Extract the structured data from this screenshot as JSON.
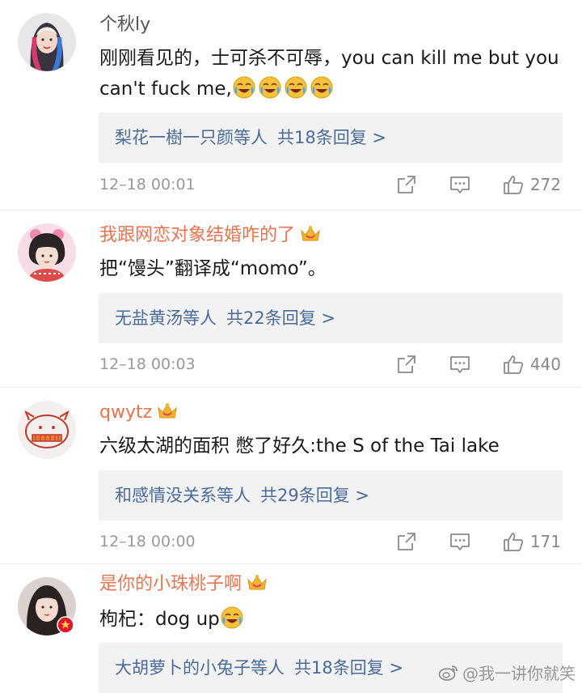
{
  "comments": [
    {
      "username": "个秋ly",
      "is_vip": false,
      "text": "刚刚看见的，士可杀不可辱，you can kill me but you can't fuck me,",
      "emoji_count": 4,
      "reply_users": "梨花一樹一只颜等人",
      "reply_count": "共18条回复 >",
      "time": "12–18 00:01",
      "likes": "272"
    },
    {
      "username": "我跟网恋对象结婚咋的了",
      "is_vip": true,
      "text": "把“馒头”翻译成“momo”。",
      "emoji_count": 0,
      "reply_users": "无盐黄汤等人",
      "reply_count": "共22条回复 >",
      "time": "12–18 00:03",
      "likes": "440"
    },
    {
      "username": "qwytz",
      "is_vip": true,
      "text": "六级太湖的面积 憋了好久:the S of the Tai lake",
      "emoji_count": 0,
      "reply_users": "和感情没关系等人",
      "reply_count": "共29条回复 >",
      "time": "12–18 00:00",
      "likes": "171"
    },
    {
      "username": "是你的小珠桃子啊",
      "is_vip": true,
      "text": "枸杞：dog up",
      "emoji_count": 1,
      "reply_users": "大胡萝卜的小兔子等人",
      "reply_count": "共18条回复 >"
    }
  ],
  "icons": {
    "share": "share-icon",
    "comment": "comment-icon",
    "like": "thumbs-up-icon",
    "vip": "crown-icon",
    "emoji": "laugh-cry-emoji"
  },
  "watermark": "@我一讲你就笑",
  "colors": {
    "username": "#eb7350",
    "link": "#4a6b9a",
    "meta": "#999999",
    "reply_bg": "#f2f2f2"
  }
}
